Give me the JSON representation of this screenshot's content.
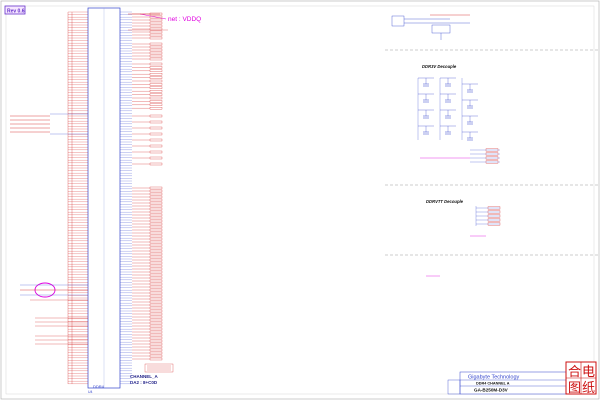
{
  "sheet": {
    "rev_label": "Rev 0.6",
    "net_note": "net : VDDQ",
    "stamp_text": "合电图纸",
    "colors": {
      "wire_blue": "#3344cc",
      "net_red": "#d01818",
      "magenta": "#e000e0",
      "title_purple": "#6633cc",
      "border_gray": "#aaaaaa",
      "stamp_red": "#cc1111"
    }
  },
  "memory_chip": {
    "ref": "U4",
    "value": "DDR4",
    "channel_label": "CHANNEL_A",
    "bank_label": "DA2 : 8+C0D"
  },
  "decouple": {
    "ddr3v_title": "DDR3V Decouple",
    "ddrvtt_title": "DDRVTT Decouple"
  },
  "title_block": {
    "company": "Gigabyte Technology",
    "sheet_title": "DDR4 CHANNEL A",
    "model": "GA-B250M-D3V"
  }
}
